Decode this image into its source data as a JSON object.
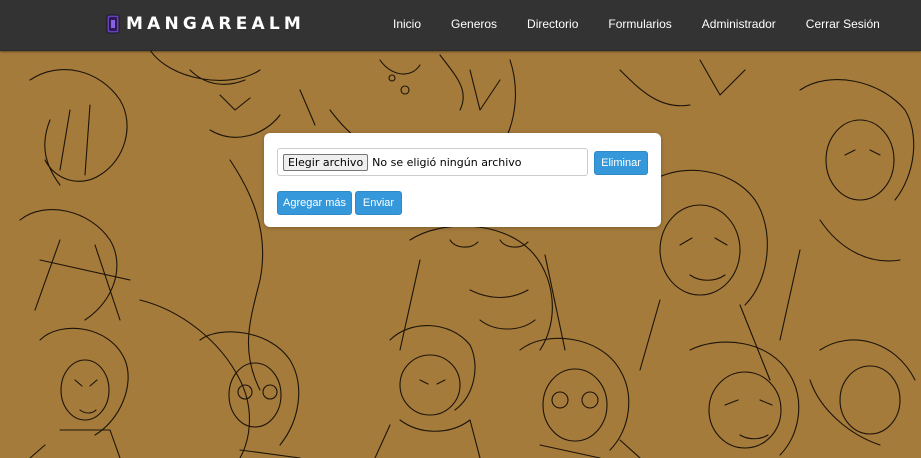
{
  "brand": {
    "name": "MANGAREALM",
    "logo_icon": "book-logo-icon",
    "logo_color": "#4b2c8a"
  },
  "nav": {
    "items": [
      {
        "label": "Inicio"
      },
      {
        "label": "Generos"
      },
      {
        "label": "Directorio"
      },
      {
        "label": "Formularios"
      },
      {
        "label": "Administrador"
      },
      {
        "label": "Cerrar Sesión"
      }
    ]
  },
  "upload_form": {
    "file_button_label": "Elegir archivo",
    "file_status": "No se eligió ningún archivo",
    "remove_label": "Eliminar",
    "add_more_label": "Agregar más",
    "submit_label": "Enviar"
  },
  "colors": {
    "navbar": "#333333",
    "background": "#a57b3c",
    "button": "#3498db"
  }
}
